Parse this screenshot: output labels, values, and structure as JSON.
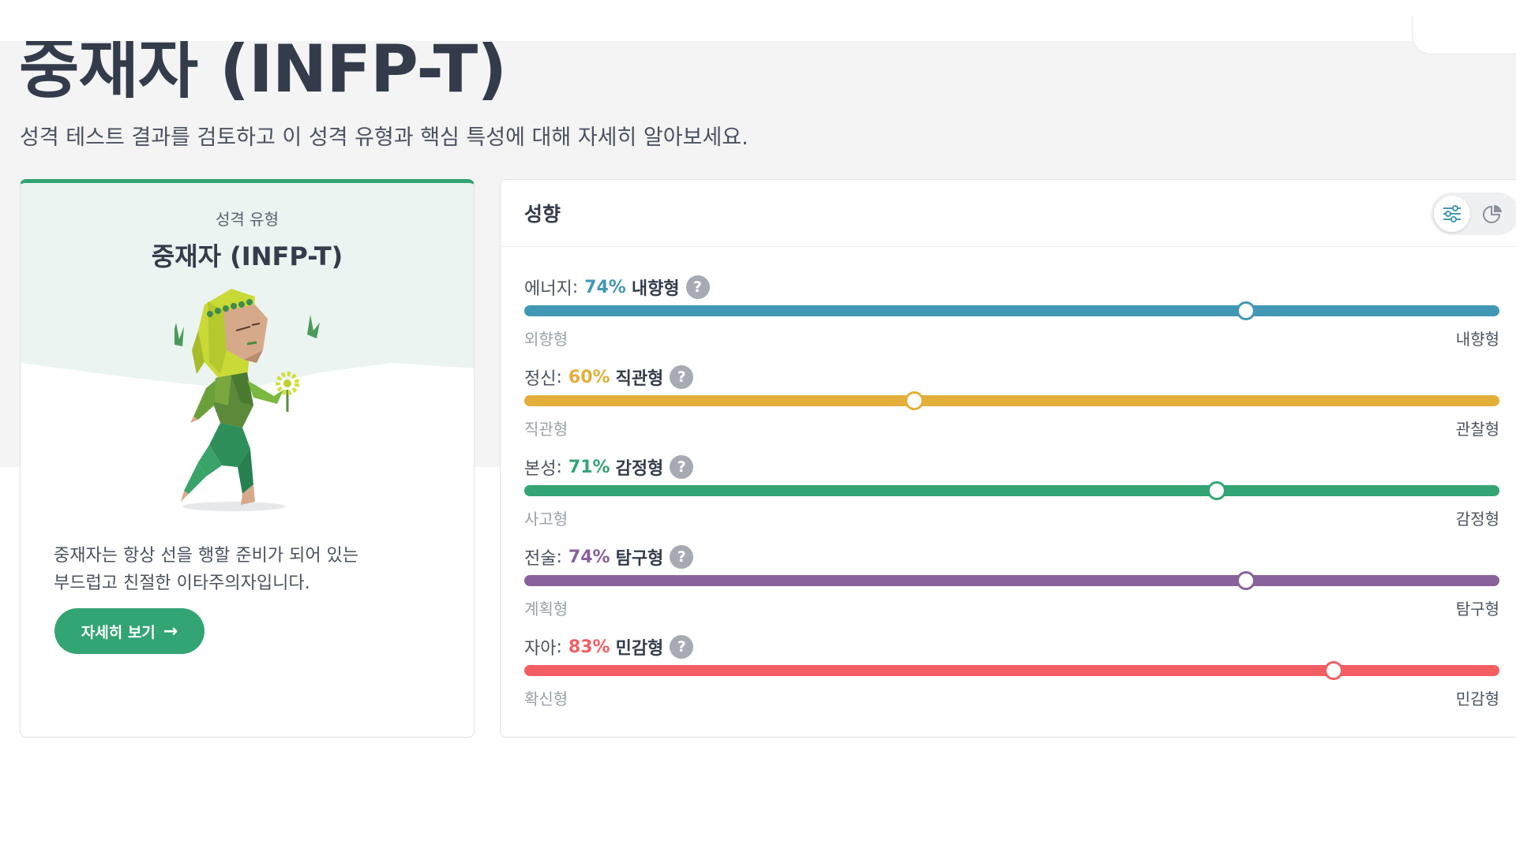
{
  "page": {
    "title": "중재자 (INFP-T)",
    "subtitle": "성격 테스트 결과를 검토하고 이 성격 유형과 핵심 특성에 대해 자세히 알아보세요."
  },
  "type_card": {
    "label": "성격 유형",
    "type": "중재자 (INFP-T)",
    "illustration_icon": "mediator-character-illustration",
    "description_line1": "중재자는 항상 선을 행할 준비가 되어 있는",
    "description_line2": "부드럽고 친절한 이타주의자입니다.",
    "button_label": "자세히 보기",
    "button_icon": "arrow-right-icon",
    "accent_color": "#33a474"
  },
  "traits_card": {
    "title": "성향",
    "view_toggle": [
      {
        "icon": "sliders-icon",
        "active": true
      },
      {
        "icon": "pie-chart-icon",
        "active": false
      }
    ],
    "traits": [
      {
        "name": "에너지",
        "percent": 74,
        "percent_label": "74%",
        "dominant": "내향형",
        "left_label": "외향형",
        "right_label": "내향형",
        "color": "#4298b4"
      },
      {
        "name": "정신",
        "percent": 60,
        "percent_label": "60%",
        "dominant": "직관형",
        "left_label": "직관형",
        "right_label": "관찰형",
        "color": "#e4ae3a"
      },
      {
        "name": "본성",
        "percent": 71,
        "percent_label": "71%",
        "dominant": "감정형",
        "left_label": "사고형",
        "right_label": "감정형",
        "color": "#33a474"
      },
      {
        "name": "전술",
        "percent": 74,
        "percent_label": "74%",
        "dominant": "탐구형",
        "left_label": "계획형",
        "right_label": "탐구형",
        "color": "#88619a"
      },
      {
        "name": "자아",
        "percent": 83,
        "percent_label": "83%",
        "dominant": "민감형",
        "left_label": "확신형",
        "right_label": "민감형",
        "color": "#f25e62"
      }
    ],
    "help_label": "?"
  }
}
